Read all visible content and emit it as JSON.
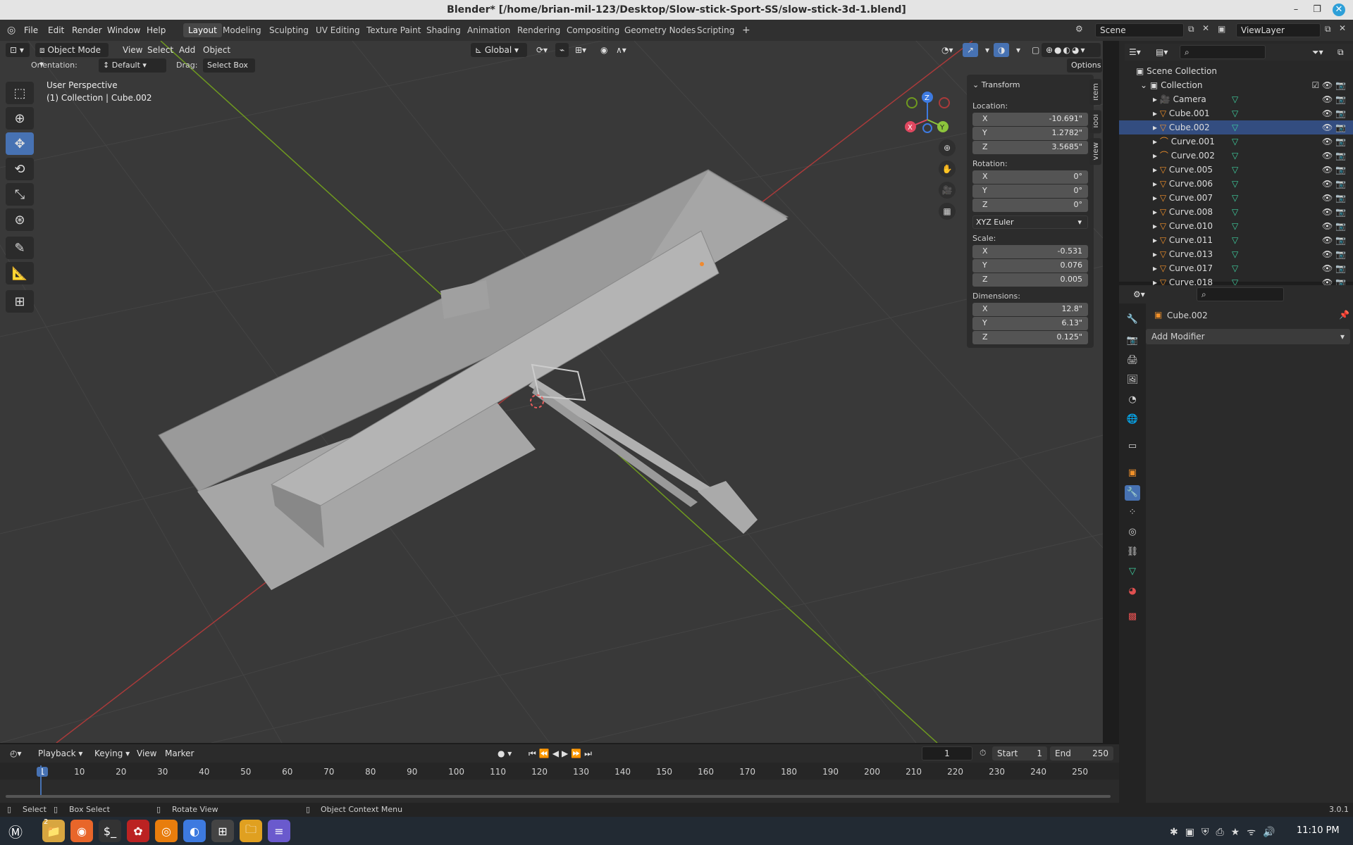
{
  "window": {
    "title": "Blender* [/home/brian-mil-123/Desktop/Slow-stick-Sport-SS/slow-stick-3d-1.blend]",
    "minimize": "–",
    "maximize": "❐",
    "close": "✕"
  },
  "menus": [
    "File",
    "Edit",
    "Render",
    "Window",
    "Help"
  ],
  "workspaces": [
    "Layout",
    "Modeling",
    "Sculpting",
    "UV Editing",
    "Texture Paint",
    "Shading",
    "Animation",
    "Rendering",
    "Compositing",
    "Geometry Nodes",
    "Scripting"
  ],
  "scene": {
    "name": "Scene",
    "view_layer": "ViewLayer"
  },
  "viewport": {
    "mode": "Object Mode",
    "menus": [
      "View",
      "Select",
      "Add",
      "Object"
    ],
    "transform_space": "Global",
    "orientation_label": "Orientation:",
    "orientation_value": "Default",
    "drag_label": "Drag:",
    "drag_value": "Select Box",
    "options": "Options",
    "overlay_title": "User Perspective",
    "overlay_sub": "(1) Collection | Cube.002",
    "gizmo": {
      "x": "X",
      "y": "Y",
      "z": "Z"
    }
  },
  "npanel": {
    "header": "Transform",
    "tabs": [
      "Item",
      "Tool",
      "View"
    ],
    "location_label": "Location:",
    "location": [
      {
        "axis": "X",
        "value": "-10.691\""
      },
      {
        "axis": "Y",
        "value": "1.2782\""
      },
      {
        "axis": "Z",
        "value": "3.5685\""
      }
    ],
    "rotation_label": "Rotation:",
    "rotation": [
      {
        "axis": "X",
        "value": "0°"
      },
      {
        "axis": "Y",
        "value": "0°"
      },
      {
        "axis": "Z",
        "value": "0°"
      }
    ],
    "rotation_mode": "XYZ Euler",
    "scale_label": "Scale:",
    "scale": [
      {
        "axis": "X",
        "value": "-0.531"
      },
      {
        "axis": "Y",
        "value": "0.076"
      },
      {
        "axis": "Z",
        "value": "0.005"
      }
    ],
    "dimensions_label": "Dimensions:",
    "dimensions": [
      {
        "axis": "X",
        "value": "12.8\""
      },
      {
        "axis": "Y",
        "value": "6.13\""
      },
      {
        "axis": "Z",
        "value": "0.125\""
      }
    ]
  },
  "outliner": {
    "root": "Scene Collection",
    "collection": "Collection",
    "items": [
      "Camera",
      "Cube.001",
      "Cube.002",
      "Curve.001",
      "Curve.002",
      "Curve.005",
      "Curve.006",
      "Curve.007",
      "Curve.008",
      "Curve.010",
      "Curve.011",
      "Curve.013",
      "Curve.017",
      "Curve.018"
    ]
  },
  "properties": {
    "object_name": "Cube.002",
    "add_modifier": "Add Modifier"
  },
  "timeline": {
    "menus": [
      "Playback",
      "Keying",
      "View",
      "Marker"
    ],
    "current_frame": "1",
    "start_label": "Start",
    "start": "1",
    "end_label": "End",
    "end": "250",
    "ticks": [
      "1",
      "10",
      "20",
      "30",
      "40",
      "50",
      "60",
      "70",
      "80",
      "90",
      "100",
      "110",
      "120",
      "130",
      "140",
      "150",
      "160",
      "170",
      "180",
      "190",
      "200",
      "210",
      "220",
      "230",
      "240",
      "250"
    ]
  },
  "status": {
    "select": "Select",
    "box_select": "Box Select",
    "rotate": "Rotate View",
    "context": "Object Context Menu",
    "version": "3.0.1"
  },
  "taskbar": {
    "clock": "11:10 PM",
    "badge": "2"
  },
  "colors": {
    "accent": "#4772b3",
    "x_axis": "#a93a3a",
    "y_axis": "#6f9a1f",
    "selected_row": "#334d80"
  }
}
